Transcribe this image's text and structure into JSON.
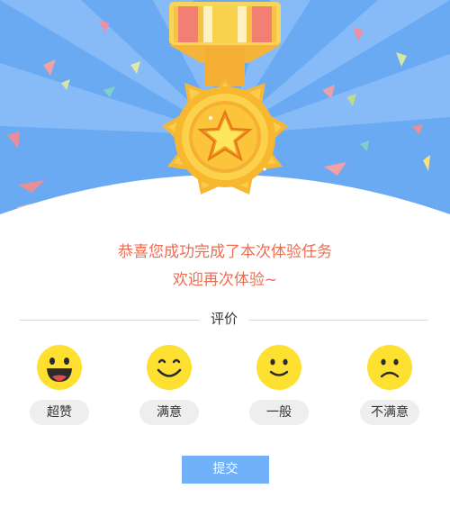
{
  "congrats": {
    "line1": "恭喜您成功完成了本次体验任务",
    "line2": "欢迎再次体验~"
  },
  "rating": {
    "title": "评价",
    "options": [
      {
        "label": "超赞",
        "icon": "laughing-face-icon"
      },
      {
        "label": "满意",
        "icon": "smiling-face-icon"
      },
      {
        "label": "一般",
        "icon": "slight-smile-face-icon"
      },
      {
        "label": "不满意",
        "icon": "frowning-face-icon"
      }
    ]
  },
  "submit_label": "提交",
  "colors": {
    "banner_blue": "#6aaaf3",
    "text_accent": "#ef6b4f",
    "face_yellow": "#fde030",
    "button_blue": "#70b1f9"
  }
}
